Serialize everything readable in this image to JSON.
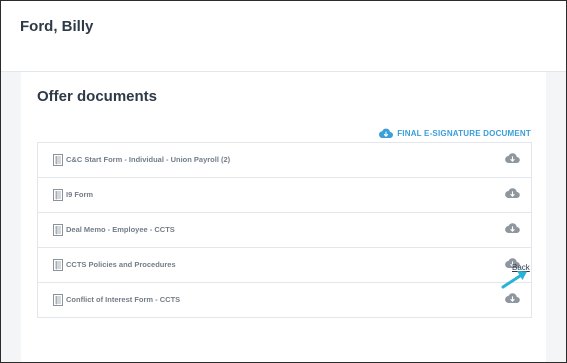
{
  "header": {
    "name": "Ford, Billy"
  },
  "offer": {
    "title": "Offer documents",
    "esign_label": "FINAL E-SIGNATURE DOCUMENT",
    "documents": [
      {
        "label": "C&C Start Form - Individual - Union Payroll (2)"
      },
      {
        "label": "I9 Form"
      },
      {
        "label": "Deal Memo - Employee - CCTS"
      },
      {
        "label": "CCTS Policies and Procedures"
      },
      {
        "label": "Conflict of Interest Form - CCTS"
      }
    ]
  },
  "footer": {
    "back_label": "Back"
  },
  "colors": {
    "accent": "#3a9ed8",
    "annotation_arrow": "#29b3d6",
    "heading": "#2e3a48",
    "muted": "#737d88"
  },
  "icons": {
    "document": "document-list-icon",
    "download": "cloud-download-icon",
    "esign": "cloud-download-icon"
  }
}
